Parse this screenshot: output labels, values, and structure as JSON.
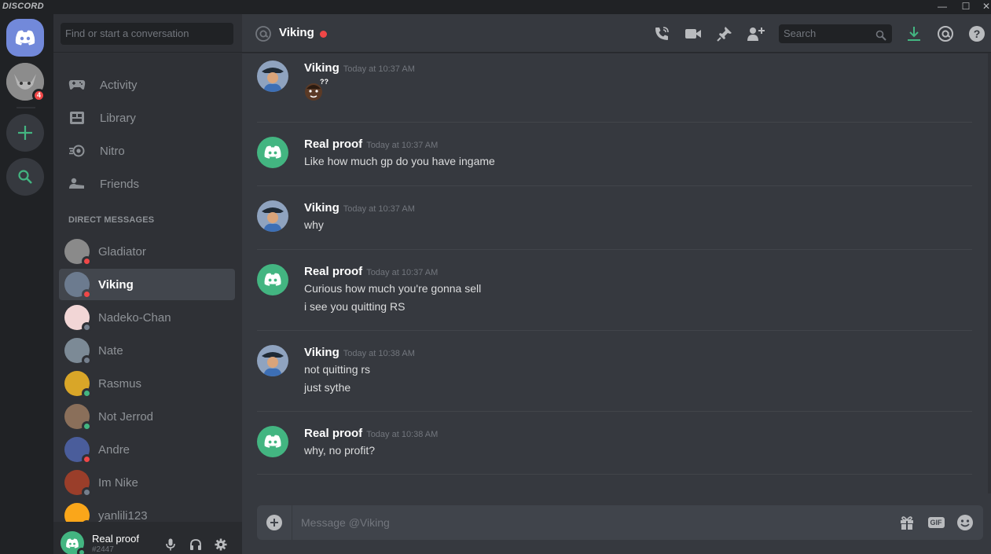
{
  "window": {
    "app_name": "DISCORD",
    "minimize": "—",
    "maximize": "☐",
    "close": "✕"
  },
  "guilds": {
    "badge": "4"
  },
  "sidebar": {
    "search_placeholder": "Find or start a conversation",
    "nav": [
      {
        "label": "Activity",
        "icon": "gamepad-icon"
      },
      {
        "label": "Library",
        "icon": "library-icon"
      },
      {
        "label": "Nitro",
        "icon": "nitro-icon"
      },
      {
        "label": "Friends",
        "icon": "friends-icon"
      }
    ],
    "dm_header": "DIRECT MESSAGES",
    "dms": [
      {
        "name": "Gladiator",
        "status": "#f04747",
        "color": "#8a8a8a"
      },
      {
        "name": "Viking",
        "status": "#f04747",
        "color": "#6c7b8f",
        "active": true
      },
      {
        "name": "Nadeko-Chan",
        "status": "#747f8d",
        "color": "#f2d6d6"
      },
      {
        "name": "Nate",
        "status": "#747f8d",
        "color": "#7c8a96"
      },
      {
        "name": "Rasmus",
        "status": "#43b581",
        "color": "#d9a628"
      },
      {
        "name": "Not Jerrod",
        "status": "#43b581",
        "color": "#8a6f5a"
      },
      {
        "name": "Andre",
        "status": "#f04747",
        "color": "#4a5d9b"
      },
      {
        "name": "Im Nike",
        "status": "#747f8d",
        "color": "#9a3e2a"
      },
      {
        "name": "yanlili123",
        "status": "#43b581",
        "color": "#faa61a"
      }
    ]
  },
  "user": {
    "name": "Real proof",
    "tag": "#2447"
  },
  "header": {
    "title": "Viking",
    "search_placeholder": "Search"
  },
  "messages": [
    {
      "author": "Viking",
      "time": "Today at 10:37 AM",
      "lines": [],
      "emoji": "??"
    },
    {
      "author": "Real proof",
      "time": "Today at 10:37 AM",
      "lines": [
        "Like how much gp do you have ingame"
      ]
    },
    {
      "author": "Viking",
      "time": "Today at 10:37 AM",
      "lines": [
        "why"
      ]
    },
    {
      "author": "Real proof",
      "time": "Today at 10:37 AM",
      "lines": [
        "Curious how much you're gonna sell",
        "i see you quitting RS"
      ]
    },
    {
      "author": "Viking",
      "time": "Today at 10:38 AM",
      "lines": [
        "not quitting rs",
        "just sythe"
      ]
    },
    {
      "author": "Real proof",
      "time": "Today at 10:38 AM",
      "lines": [
        "why, no profit?"
      ]
    }
  ],
  "composer": {
    "placeholder": "Message @Viking",
    "gif_label": "GIF"
  }
}
